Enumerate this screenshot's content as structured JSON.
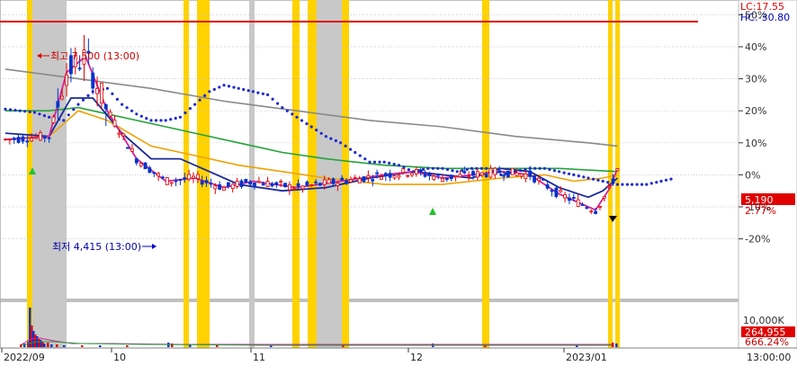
{
  "chart_data": {
    "type": "line",
    "header": {
      "lc": "LC:17.55",
      "hc": "HC:-30.80"
    },
    "x_axis": {
      "labels": [
        "2022/09",
        "10",
        "11",
        "12",
        "2023/01"
      ],
      "time_label": "13:00:00"
    },
    "price_axis": {
      "ticks": [
        "50%",
        "40%",
        "30%",
        "20%",
        "10%",
        "0%",
        "-10%",
        "-20%"
      ],
      "values": [
        50,
        40,
        30,
        20,
        10,
        0,
        -10,
        -20
      ],
      "ylim": [
        -30.8,
        17.55
      ]
    },
    "volume_axis": {
      "ticks": [
        "10,000K"
      ],
      "current_volume": "264,955",
      "volume_ratio": "666.24%"
    },
    "current": {
      "price": "5,190",
      "change": "2.77%"
    },
    "annotations": {
      "high": "최고 7,500 (13:00)",
      "low": "최저 4,415 (13:00)"
    },
    "series": [
      {
        "id": "purple-dotted",
        "points": [
          [
            0,
            20.5
          ],
          [
            10,
            20
          ],
          [
            20,
            19.5
          ],
          [
            30,
            18
          ],
          [
            40,
            17
          ],
          [
            50,
            22
          ],
          [
            60,
            26
          ],
          [
            70,
            27
          ],
          [
            80,
            22
          ],
          [
            90,
            19
          ],
          [
            100,
            17
          ],
          [
            110,
            17
          ],
          [
            120,
            18
          ],
          [
            130,
            22
          ],
          [
            140,
            26
          ],
          [
            150,
            28
          ],
          [
            160,
            27
          ],
          [
            170,
            26
          ],
          [
            180,
            25
          ],
          [
            190,
            21
          ],
          [
            200,
            18
          ],
          [
            210,
            15
          ],
          [
            220,
            12
          ],
          [
            230,
            10
          ],
          [
            240,
            7
          ],
          [
            250,
            4
          ],
          [
            260,
            4
          ],
          [
            270,
            3
          ],
          [
            280,
            1
          ],
          [
            290,
            2
          ],
          [
            300,
            2
          ],
          [
            310,
            1
          ],
          [
            320,
            2
          ],
          [
            330,
            2
          ],
          [
            340,
            0
          ],
          [
            350,
            1
          ],
          [
            360,
            2
          ],
          [
            370,
            2
          ],
          [
            380,
            1
          ],
          [
            390,
            0
          ],
          [
            400,
            -1
          ],
          [
            410,
            -2
          ],
          [
            420,
            -3
          ],
          [
            430,
            -3
          ],
          [
            440,
            -3
          ],
          [
            450,
            -2
          ],
          [
            460,
            -1
          ]
        ]
      },
      {
        "id": "gray-long",
        "points": [
          [
            0,
            33
          ],
          [
            50,
            30
          ],
          [
            100,
            27
          ],
          [
            150,
            23
          ],
          [
            200,
            20
          ],
          [
            250,
            17
          ],
          [
            300,
            15
          ],
          [
            350,
            12
          ],
          [
            400,
            10
          ],
          [
            420,
            9
          ]
        ]
      },
      {
        "id": "green-ma",
        "points": [
          [
            0,
            20
          ],
          [
            30,
            20
          ],
          [
            50,
            21
          ],
          [
            70,
            19
          ],
          [
            100,
            16
          ],
          [
            130,
            13
          ],
          [
            160,
            10
          ],
          [
            190,
            7
          ],
          [
            220,
            5
          ],
          [
            260,
            3
          ],
          [
            300,
            2
          ],
          [
            340,
            2
          ],
          [
            380,
            2
          ],
          [
            420,
            1
          ]
        ]
      },
      {
        "id": "orange-ma",
        "points": [
          [
            0,
            11
          ],
          [
            30,
            12
          ],
          [
            50,
            20
          ],
          [
            70,
            17
          ],
          [
            100,
            9
          ],
          [
            130,
            6
          ],
          [
            160,
            3
          ],
          [
            190,
            1
          ],
          [
            220,
            -1
          ],
          [
            260,
            -3
          ],
          [
            300,
            -3
          ],
          [
            340,
            -1
          ],
          [
            370,
            0
          ],
          [
            390,
            -2
          ],
          [
            410,
            -1
          ],
          [
            420,
            0
          ]
        ]
      },
      {
        "id": "navy-ma",
        "points": [
          [
            0,
            13
          ],
          [
            30,
            12
          ],
          [
            45,
            24
          ],
          [
            60,
            24
          ],
          [
            80,
            13
          ],
          [
            100,
            5
          ],
          [
            120,
            5
          ],
          [
            140,
            1
          ],
          [
            160,
            -3
          ],
          [
            190,
            -5
          ],
          [
            220,
            -4
          ],
          [
            250,
            -1
          ],
          [
            280,
            1
          ],
          [
            300,
            0
          ],
          [
            320,
            -1
          ],
          [
            340,
            2
          ],
          [
            360,
            1
          ],
          [
            380,
            -4
          ],
          [
            400,
            -7
          ],
          [
            410,
            -5
          ],
          [
            420,
            -1
          ]
        ]
      },
      {
        "id": "magenta-ma",
        "points": [
          [
            0,
            11
          ],
          [
            30,
            12
          ],
          [
            42,
            32
          ],
          [
            55,
            37
          ],
          [
            70,
            20
          ],
          [
            90,
            5
          ],
          [
            110,
            -2
          ],
          [
            130,
            -1
          ],
          [
            150,
            -4
          ],
          [
            170,
            -2
          ],
          [
            200,
            -4
          ],
          [
            230,
            -2
          ],
          [
            260,
            0
          ],
          [
            280,
            1
          ],
          [
            300,
            -1
          ],
          [
            320,
            0
          ],
          [
            340,
            1
          ],
          [
            360,
            0
          ],
          [
            380,
            -6
          ],
          [
            395,
            -9
          ],
          [
            405,
            -11
          ],
          [
            415,
            -4
          ],
          [
            420,
            2
          ]
        ]
      }
    ]
  }
}
